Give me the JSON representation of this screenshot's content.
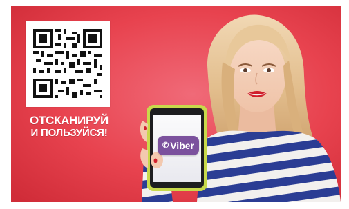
{
  "promo": {
    "caption_line1": "ОТСКАНИРУЙ",
    "caption_line2": "И ПОЛЬЗУЙСЯ!",
    "logo_text": "Viber"
  },
  "colors": {
    "background_red": "#e63a4f",
    "viber_purple": "#7b519d",
    "sweater_blue": "#2a3a8f",
    "hair_blonde": "#e6c59c"
  },
  "icons": [
    "qr-code-icon",
    "phone-icon"
  ]
}
